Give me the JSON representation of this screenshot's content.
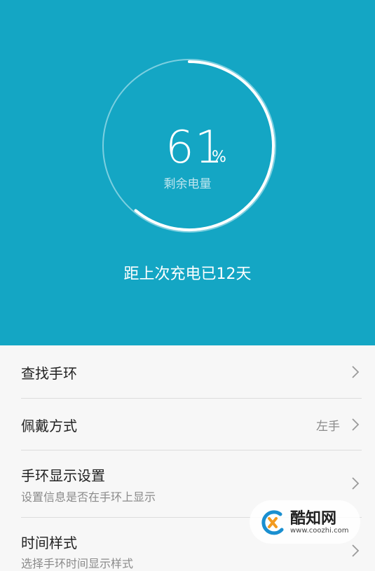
{
  "battery": {
    "percent_value": "61",
    "percent_unit": "%",
    "level_fraction": 0.61,
    "label": "剩余电量",
    "since_charge": "距上次充电已12天"
  },
  "settings": [
    {
      "title": "查找手环"
    },
    {
      "title": "佩戴方式",
      "value": "左手"
    },
    {
      "title": "手环显示设置",
      "subtitle": "设置信息是否在手环上显示"
    },
    {
      "title": "时间样式",
      "subtitle": "选择手环时间显示样式"
    }
  ],
  "watermark": {
    "brand": "酷知网",
    "url": "www.coozhi.com"
  },
  "colors": {
    "header_bg": "#14a6c4",
    "list_bg": "#f7f7f7",
    "divider": "#dcdcdc"
  },
  "icons": {
    "chevron": "chevron-right-icon",
    "logo": "coozhi-logo-icon"
  }
}
